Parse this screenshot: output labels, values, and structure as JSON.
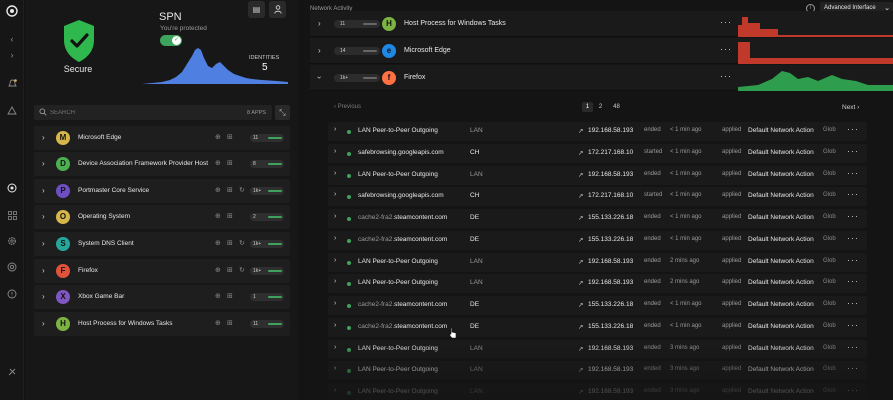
{
  "rail": {
    "items": [
      {
        "icon": "logo-icon"
      },
      {
        "icon": "chevron-right-icon"
      },
      {
        "icon": "bell-icon"
      },
      {
        "icon": "warning-icon"
      },
      {
        "icon": "network-icon"
      },
      {
        "icon": "apps-icon"
      },
      {
        "icon": "settings-icon"
      },
      {
        "icon": "support-icon"
      },
      {
        "icon": "help-icon"
      },
      {
        "icon": "power-icon"
      }
    ]
  },
  "status": {
    "label": "Secure",
    "shield_color": "#2fb84e"
  },
  "spn": {
    "title": "SPN",
    "subtitle": "You're protected",
    "enabled": true,
    "identities_label": "IDENTITIES",
    "identities_value": "5",
    "chart_color": "#4f7fe0"
  },
  "search": {
    "placeholder": "SEARCH",
    "apps_count": "8 APPS"
  },
  "apps": [
    {
      "letter": "M",
      "name": "Microsoft Edge",
      "color": "#d6b64a",
      "count": "11",
      "icons": [
        "globe-icon",
        "grid-icon"
      ]
    },
    {
      "letter": "D",
      "name": "Device Association Framework Provider Host",
      "color": "#4caf50",
      "count": "8",
      "icons": [
        "globe-icon",
        "grid-icon"
      ]
    },
    {
      "letter": "P",
      "name": "Portmaster Core Service",
      "color": "#6d4fc2",
      "count": "1k+",
      "icons": [
        "globe-icon",
        "grid-icon",
        "refresh-icon"
      ]
    },
    {
      "letter": "O",
      "name": "Operating System",
      "color": "#d6b64a",
      "count": "2",
      "icons": [
        "globe-icon",
        "grid-icon"
      ]
    },
    {
      "letter": "S",
      "name": "System DNS Client",
      "color": "#26a69a",
      "count": "1k+",
      "icons": [
        "globe-icon",
        "grid-icon",
        "refresh-icon"
      ]
    },
    {
      "letter": "F",
      "name": "Firefox",
      "color": "#e0533b",
      "count": "1k+",
      "icons": [
        "globe-icon",
        "grid-icon",
        "refresh-icon"
      ]
    },
    {
      "letter": "X",
      "name": "Xbox Game Bar",
      "color": "#7e57c2",
      "count": "1",
      "icons": [
        "globe-icon",
        "grid-icon"
      ]
    },
    {
      "letter": "H",
      "name": "Host Process for Windows Tasks",
      "color": "#7cb342",
      "count": "11",
      "icons": [
        "globe-icon",
        "grid-icon"
      ]
    }
  ],
  "network": {
    "title": "Network Activity",
    "mode": "Advanced Interface",
    "processes": [
      {
        "name": "Host Process for Windows Tasks",
        "count": "11",
        "letter": "H",
        "color": "#7cb342",
        "spark_color": "#c0392b"
      },
      {
        "name": "Microsoft Edge",
        "count": "14",
        "letter": "e",
        "color": "#1e88e5",
        "spark_color": "#c0392b"
      },
      {
        "name": "Firefox",
        "count": "1k+",
        "letter": "f",
        "color": "#ff7043",
        "spark_color": "#2e9d4e"
      }
    ],
    "pager": {
      "prev": "Previous",
      "next": "Next",
      "pages": [
        "1",
        "2",
        "48"
      ],
      "current": "1"
    },
    "connections": [
      {
        "domain": "LAN Peer-to-Peer Outgoing",
        "prefix": "",
        "country": "LAN",
        "ip": "192.168.58.193",
        "state": "ended",
        "time": "< 1 min ago",
        "applied": "applied",
        "action": "Default Network Action",
        "scope": "Glob"
      },
      {
        "domain": "safebrowsing.googleapis.com",
        "prefix": "",
        "country": "CH",
        "ip": "172.217.168.10",
        "state": "started",
        "time": "< 1 min ago",
        "applied": "applied",
        "action": "Default Network Action",
        "scope": "Glob"
      },
      {
        "domain": "LAN Peer-to-Peer Outgoing",
        "prefix": "",
        "country": "LAN",
        "ip": "192.168.58.193",
        "state": "ended",
        "time": "< 1 min ago",
        "applied": "applied",
        "action": "Default Network Action",
        "scope": "Glob"
      },
      {
        "domain": "safebrowsing.googleapis.com",
        "prefix": "",
        "country": "CH",
        "ip": "172.217.168.10",
        "state": "started",
        "time": "< 1 min ago",
        "applied": "applied",
        "action": "Default Network Action",
        "scope": "Glob"
      },
      {
        "domain": "steamcontent.com",
        "prefix": "cache2-fra2.",
        "country": "DE",
        "ip": "155.133.226.18",
        "state": "ended",
        "time": "< 1 min ago",
        "applied": "applied",
        "action": "Default Network Action",
        "scope": "Glob"
      },
      {
        "domain": "steamcontent.com",
        "prefix": "cache2-fra2.",
        "country": "DE",
        "ip": "155.133.226.18",
        "state": "ended",
        "time": "< 1 min ago",
        "applied": "applied",
        "action": "Default Network Action",
        "scope": "Glob"
      },
      {
        "domain": "LAN Peer-to-Peer Outgoing",
        "prefix": "",
        "country": "LAN",
        "ip": "192.168.58.193",
        "state": "ended",
        "time": "2 mins ago",
        "applied": "applied",
        "action": "Default Network Action",
        "scope": "Glob"
      },
      {
        "domain": "LAN Peer-to-Peer Outgoing",
        "prefix": "",
        "country": "LAN",
        "ip": "192.168.58.193",
        "state": "ended",
        "time": "2 mins ago",
        "applied": "applied",
        "action": "Default Network Action",
        "scope": "Glob"
      },
      {
        "domain": "steamcontent.com",
        "prefix": "cache2-fra2.",
        "country": "DE",
        "ip": "155.133.226.18",
        "state": "ended",
        "time": "< 1 min ago",
        "applied": "applied",
        "action": "Default Network Action",
        "scope": "Glob"
      },
      {
        "domain": "steamcontent.com",
        "prefix": "cache2-fra2.",
        "country": "DE",
        "ip": "155.133.226.18",
        "state": "ended",
        "time": "< 1 min ago",
        "applied": "applied",
        "action": "Default Network Action",
        "scope": "Glob"
      },
      {
        "domain": "LAN Peer-to-Peer Outgoing",
        "prefix": "",
        "country": "LAN",
        "ip": "192.168.58.193",
        "state": "ended",
        "time": "3 mins ago",
        "applied": "applied",
        "action": "Default Network Action",
        "scope": "Glob"
      },
      {
        "domain": "LAN Peer-to-Peer Outgoing",
        "prefix": "",
        "country": "LAN",
        "ip": "192.168.58.193",
        "state": "ended",
        "time": "3 mins ago",
        "applied": "applied",
        "action": "Default Network Action",
        "scope": "Glob"
      },
      {
        "domain": "LAN Peer-to-Peer Outgoing",
        "prefix": "",
        "country": "LAN",
        "ip": "192.168.58.193",
        "state": "ended",
        "time": "3 mins ago",
        "applied": "applied",
        "action": "Default Network Action",
        "scope": "Glob"
      }
    ]
  }
}
